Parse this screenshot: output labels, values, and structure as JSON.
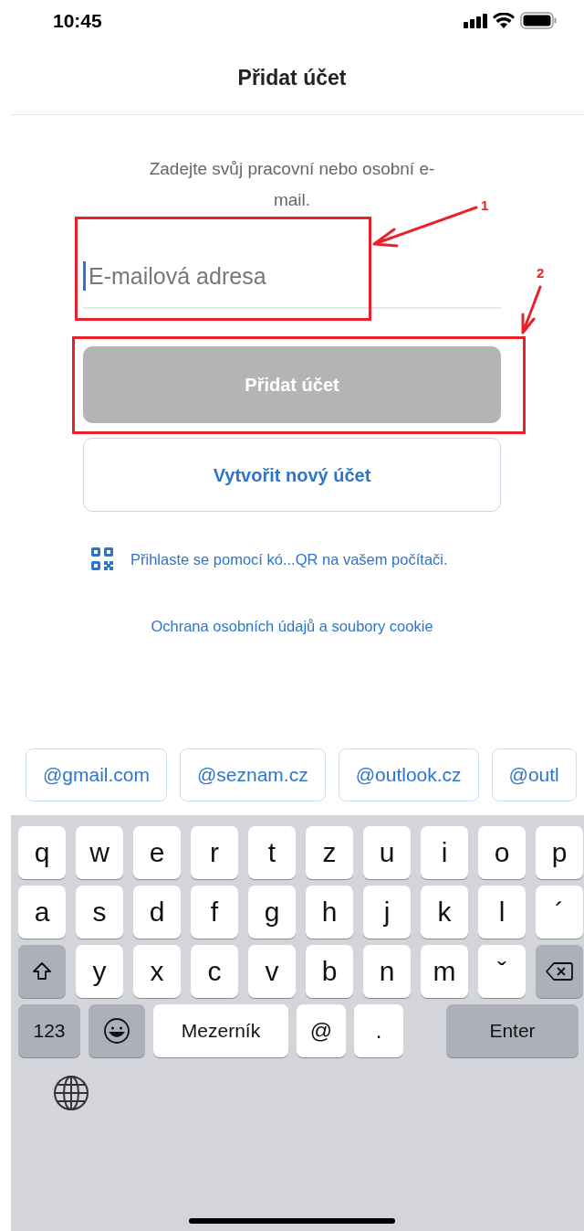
{
  "status_bar": {
    "time": "10:45"
  },
  "header": {
    "title": "Přidat účet"
  },
  "instruction": "Zadejte svůj pracovní nebo osobní e-mail.",
  "email_field": {
    "placeholder": "E-mailová adresa",
    "focused": true
  },
  "buttons": [
    {
      "label": "Přidat účet",
      "kind": "primary",
      "disabled": true
    },
    {
      "label": "Vytvořit nový účet",
      "kind": "outline",
      "disabled": false
    }
  ],
  "qr_link": "Přihlaste se pomocí kó...QR na vašem počítači.",
  "privacy_link": "Ochrana osobních údajů a soubory cookie",
  "domain_suggestions": [
    "@gmail.com",
    "@seznam.cz",
    "@outlook.cz",
    "@outl"
  ],
  "keyboard": {
    "rows": [
      [
        {
          "kind": "char",
          "label": "q"
        },
        {
          "kind": "char",
          "label": "w"
        },
        {
          "kind": "char",
          "label": "e"
        },
        {
          "kind": "char",
          "label": "r"
        },
        {
          "kind": "char",
          "label": "t"
        },
        {
          "kind": "char",
          "label": "z"
        },
        {
          "kind": "char",
          "label": "u"
        },
        {
          "kind": "char",
          "label": "i"
        },
        {
          "kind": "char",
          "label": "o"
        },
        {
          "kind": "char",
          "label": "p"
        }
      ],
      [
        {
          "kind": "char",
          "label": "a"
        },
        {
          "kind": "char",
          "label": "s"
        },
        {
          "kind": "char",
          "label": "d"
        },
        {
          "kind": "char",
          "label": "f"
        },
        {
          "kind": "char",
          "label": "g"
        },
        {
          "kind": "char",
          "label": "h"
        },
        {
          "kind": "char",
          "label": "j"
        },
        {
          "kind": "char",
          "label": "k"
        },
        {
          "kind": "char",
          "label": "l"
        },
        {
          "kind": "char",
          "label": "´"
        }
      ],
      [
        {
          "kind": "shift"
        },
        {
          "kind": "char",
          "label": "y"
        },
        {
          "kind": "char",
          "label": "x"
        },
        {
          "kind": "char",
          "label": "c"
        },
        {
          "kind": "char",
          "label": "v"
        },
        {
          "kind": "char",
          "label": "b"
        },
        {
          "kind": "char",
          "label": "n"
        },
        {
          "kind": "char",
          "label": "m"
        },
        {
          "kind": "char",
          "label": "ˇ"
        },
        {
          "kind": "backspace"
        }
      ]
    ],
    "bottom_row": [
      {
        "kind": "numbers",
        "label": "123"
      },
      {
        "kind": "emoji"
      },
      {
        "kind": "space",
        "label": "Mezerník"
      },
      {
        "kind": "symbol",
        "label": "@"
      },
      {
        "kind": "symbol",
        "label": "."
      },
      {
        "kind": "enter",
        "label": "Enter"
      }
    ]
  },
  "annotations": [
    {
      "label": "1"
    },
    {
      "label": "2"
    }
  ]
}
